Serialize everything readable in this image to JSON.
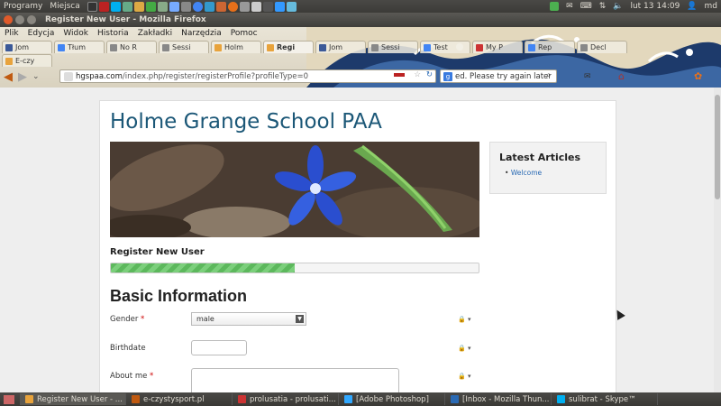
{
  "topbar": {
    "menu_apps": "Programy",
    "menu_places": "Miejsca",
    "datetime": "lut 13 14:09",
    "user": "md"
  },
  "window": {
    "title": "Register New User - Mozilla Firefox"
  },
  "menubar": [
    "Plik",
    "Edycja",
    "Widok",
    "Historia",
    "Zakładki",
    "Narzędzia",
    "Pomoc"
  ],
  "tabs": [
    {
      "label": "Jom",
      "color": "#3b5998"
    },
    {
      "label": "Tłum",
      "color": "#4285f4"
    },
    {
      "label": "No R",
      "color": "#888888"
    },
    {
      "label": "Sessi",
      "color": "#888888"
    },
    {
      "label": "Holm",
      "color": "#e8a33c"
    },
    {
      "label": "Regi",
      "color": "#e8a33c"
    },
    {
      "label": "Jom",
      "color": "#3b5998"
    },
    {
      "label": "Sessi",
      "color": "#888888"
    },
    {
      "label": "Test",
      "color": "#4285f4"
    },
    {
      "label": "My P",
      "color": "#c33"
    },
    {
      "label": "Rep",
      "color": "#4285f4"
    },
    {
      "label": "Decl",
      "color": "#888888"
    }
  ],
  "tabs_row2": [
    {
      "label": "E-czy",
      "color": "#e8a33c"
    }
  ],
  "url": {
    "host": "hgspaa.com",
    "path": "/index.php/register/registerProfile?profileType=0"
  },
  "search_text": "ed. Please try again later",
  "page": {
    "site_title": "Holme Grange School PAA",
    "register_title": "Register New User",
    "progress_fraction": 0.5,
    "section_title": "Basic Information",
    "fields": {
      "gender_label": "Gender",
      "gender_value": "male",
      "birthdate_label": "Birthdate",
      "about_label": "About me",
      "required_mark": "*"
    },
    "privacy_icon": "🔒 ▾"
  },
  "sidebar": {
    "title": "Latest Articles",
    "items": [
      "Welcome"
    ]
  },
  "taskbar": [
    {
      "label": "Register New User - ...",
      "color": "#e8a33c",
      "active": true
    },
    {
      "label": "e-czystysport.pl",
      "color": "#c05a10",
      "active": false
    },
    {
      "label": "prolusatia - prolusati...",
      "color": "#c33",
      "active": false
    },
    {
      "label": "[Adobe Photoshop]",
      "color": "#31a8ff",
      "active": false
    },
    {
      "label": "[Inbox - Mozilla Thun...",
      "color": "#2a6ab4",
      "active": false
    },
    {
      "label": "sulibrat - Skype™",
      "color": "#00aff0",
      "active": false
    }
  ]
}
